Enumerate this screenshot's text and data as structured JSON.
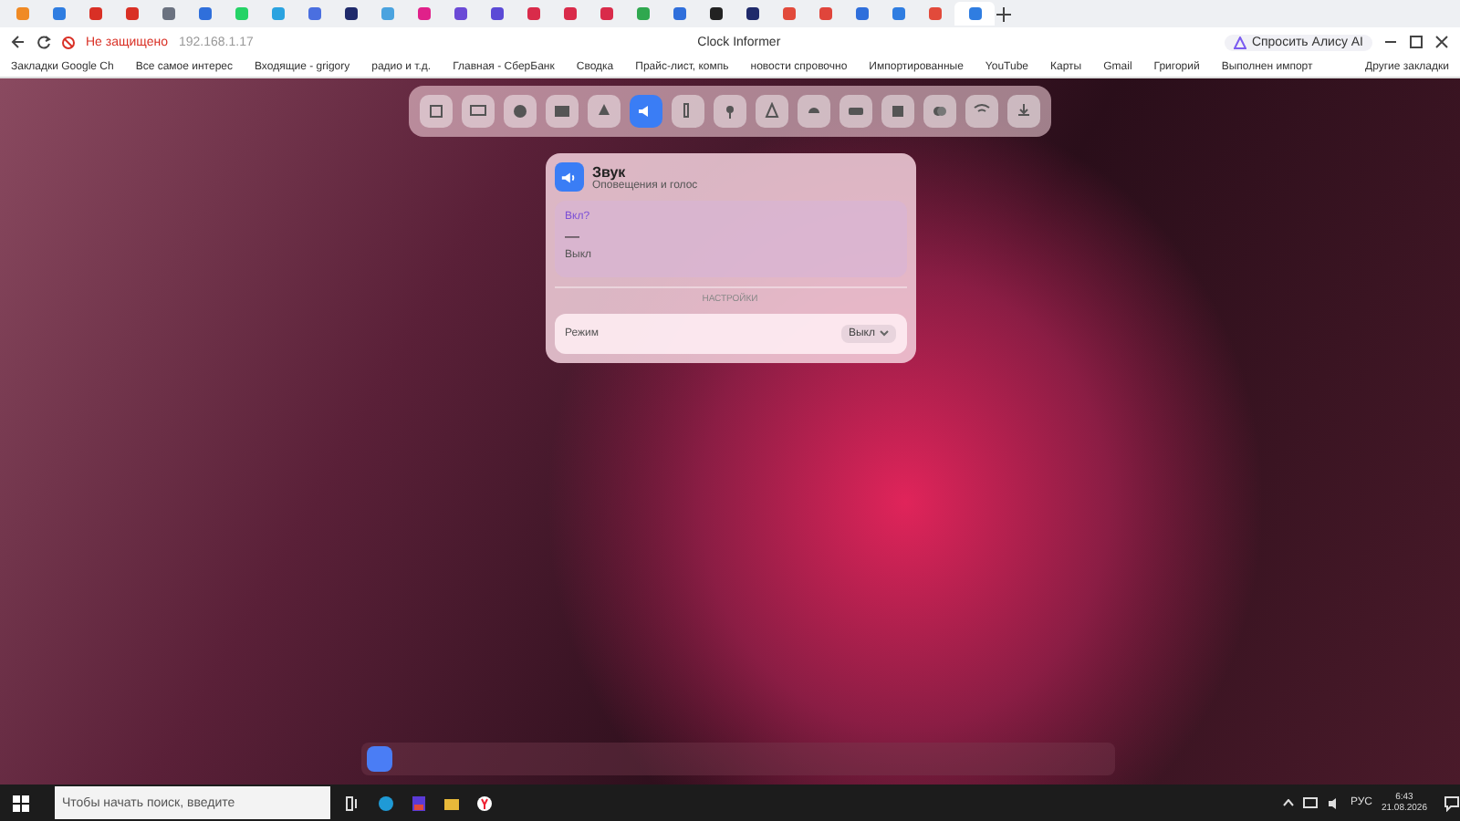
{
  "browser": {
    "tabs": [
      {
        "color": "#f08a24",
        "selected": false
      },
      {
        "color": "#2f7de1",
        "selected": false
      },
      {
        "color": "#d93025",
        "selected": false
      },
      {
        "color": "#d93025",
        "selected": false
      },
      {
        "color": "#6b7280",
        "selected": false
      },
      {
        "color": "#2f6fdb",
        "selected": false
      },
      {
        "color": "#25d366",
        "selected": false
      },
      {
        "color": "#2aa3e0",
        "selected": false
      },
      {
        "color": "#4a6fe0",
        "selected": false
      },
      {
        "color": "#1f2a6b",
        "selected": false
      },
      {
        "color": "#4aa3df",
        "selected": false
      },
      {
        "color": "#e0218a",
        "selected": false
      },
      {
        "color": "#6b4ad6",
        "selected": false
      },
      {
        "color": "#5b4ad6",
        "selected": false
      },
      {
        "color": "#d92b4a",
        "selected": false
      },
      {
        "color": "#d92b4a",
        "selected": false
      },
      {
        "color": "#d92b4a",
        "selected": false
      },
      {
        "color": "#2fa84f",
        "selected": false
      },
      {
        "color": "#2f6fdb",
        "selected": false
      },
      {
        "color": "#222222",
        "selected": false
      },
      {
        "color": "#1f2a6b",
        "selected": false
      },
      {
        "color": "#e24a3b",
        "selected": false
      },
      {
        "color": "#e0453b",
        "selected": false
      },
      {
        "color": "#2f6fdb",
        "selected": false
      },
      {
        "color": "#2f7de1",
        "selected": false
      },
      {
        "color": "#e24a3b",
        "selected": false
      },
      {
        "color": "#2f7de1",
        "selected": true
      }
    ],
    "security": "Не защищено",
    "address": "192.168.1.17",
    "page_title": "Clock Informer",
    "assistant": "Спросить Алису AI",
    "bookmarks": [
      "Закладки Google Ch",
      "Все самое интерес",
      "Входящие - grigory",
      "радио и т.д.",
      "Главная - СберБанк",
      "Сводка",
      "Прайс-лист, компь",
      "новости спровочно",
      "Импортированные",
      "YouTube",
      "Карты",
      "Gmail",
      "Григорий",
      "Выполнен импорт"
    ],
    "other_bookmarks": "Другие закладки"
  },
  "toolbar": [
    {
      "selected": false
    },
    {
      "selected": false
    },
    {
      "selected": false
    },
    {
      "selected": false
    },
    {
      "selected": false
    },
    {
      "selected": true
    },
    {
      "selected": false
    },
    {
      "selected": false
    },
    {
      "selected": false
    },
    {
      "selected": false
    },
    {
      "selected": false
    },
    {
      "selected": false
    },
    {
      "selected": false
    },
    {
      "selected": false
    },
    {
      "selected": false
    }
  ],
  "card": {
    "title": "Звук",
    "subtitle": "Оповещения и голос",
    "status_label": "Вкл?",
    "dash": "—",
    "state": "Выкл",
    "section": "НАСТРОЙКИ",
    "settings": [
      {
        "label": "Режим",
        "value": "Выкл"
      }
    ]
  },
  "taskbar": {
    "search_placeholder": "Чтобы начать поиск, введите",
    "language": "РУС",
    "time": "6:43",
    "date": "21.08.2026"
  }
}
